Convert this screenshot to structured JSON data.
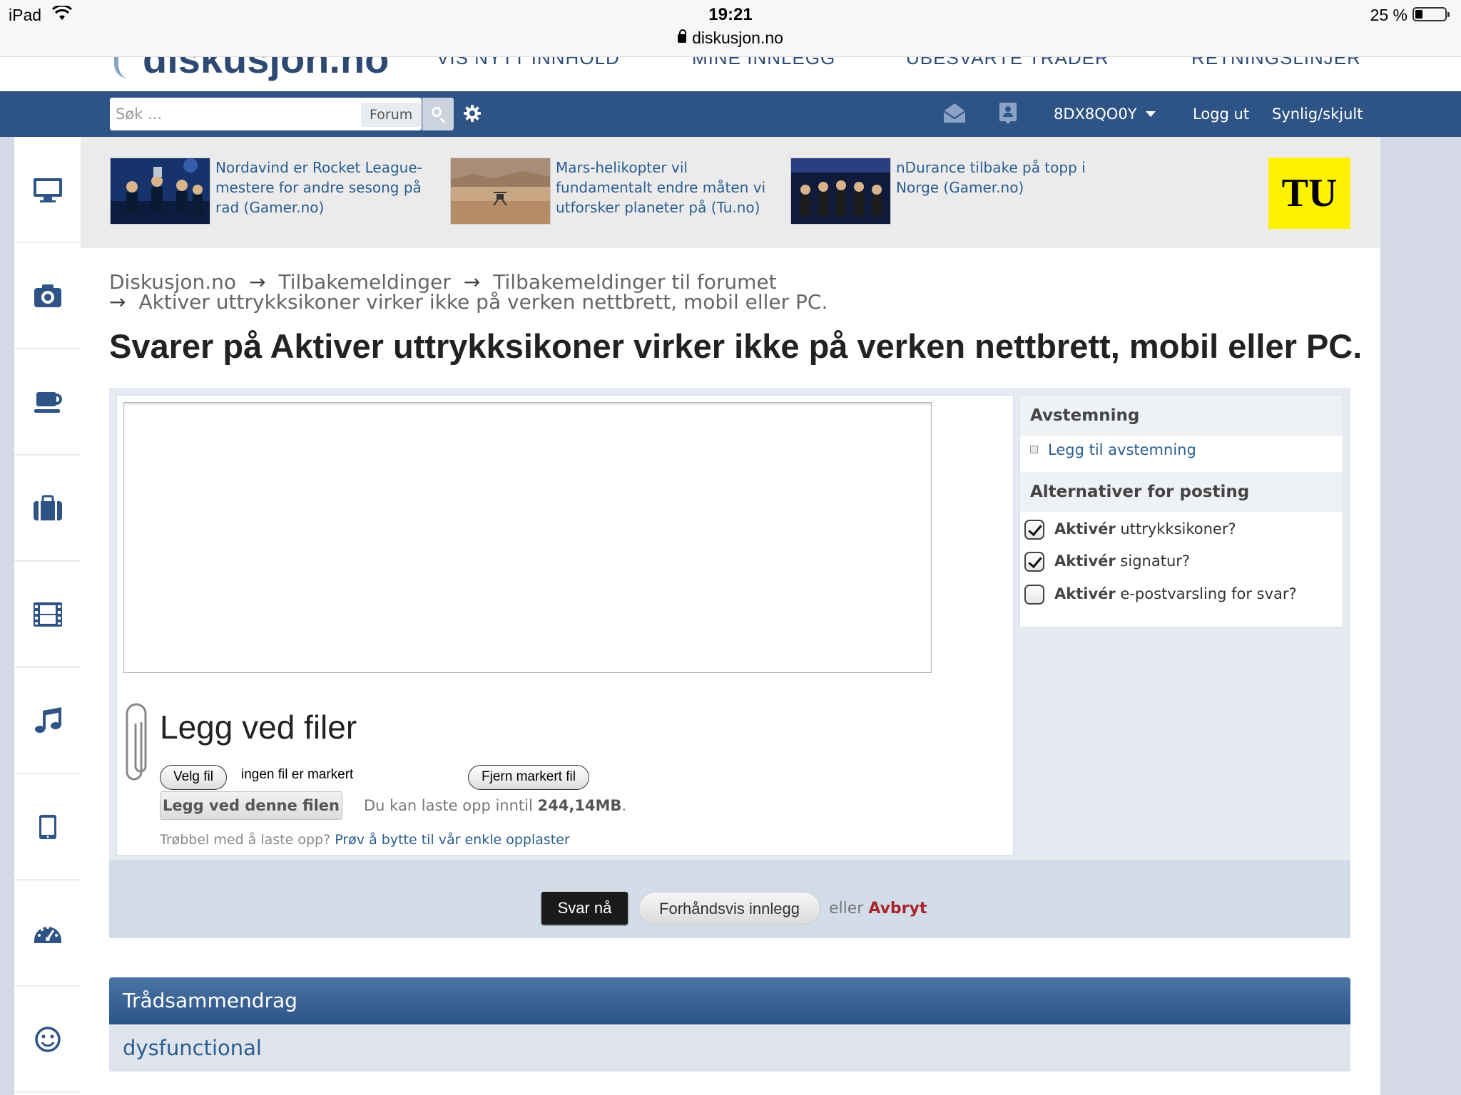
{
  "status_bar": {
    "device": "iPad",
    "time": "19:21",
    "url": "diskusjon.no",
    "battery": "25 %"
  },
  "header": {
    "nav_cut": [
      "VIS NYTT INNHOLD",
      "MINE INNLEGG",
      "UBESVARTE TRÅDER",
      "RETNINGSLINJER"
    ]
  },
  "navbar": {
    "search_placeholder": "Søk ...",
    "search_scope": "Forum",
    "username": "8DX8QO0Y",
    "logout": "Logg ut",
    "visibility": "Synlig/skjult"
  },
  "sidebar": {
    "icons": [
      "monitor-icon",
      "camera-icon",
      "coffee-icon",
      "briefcase-icon",
      "film-icon",
      "music-icon",
      "tablet-icon",
      "speedometer-icon",
      "smiley-icon"
    ]
  },
  "news": [
    {
      "text": "Nordavind er Rocket League-mestere for andre sesong på rad (Gamer.no)"
    },
    {
      "text": "Mars-helikopter vil fundamentalt endre måten vi utforsker planeter på (Tu.no)"
    },
    {
      "text": "nDurance tilbake på topp i Norge (Gamer.no)"
    }
  ],
  "ad_logo": "TU",
  "breadcrumb": {
    "items": [
      "Diskusjon.no",
      "Tilbakemeldinger",
      "Tilbakemeldinger til forumet"
    ],
    "current": "Aktiver uttrykksikoner virker ikke på verken nettbrett, mobil eller PC."
  },
  "page_title": "Svarer på Aktiver uttrykksikoner virker ikke på verken nettbrett, mobil eller PC.",
  "attach": {
    "title": "Legg ved filer",
    "choose": "Velg fil",
    "no_file": "ingen fil er markert",
    "remove": "Fjern markert fil",
    "attach_button": "Legg ved denne filen",
    "limit_prefix": "Du kan laste opp inntil ",
    "limit_value": "244,14MB",
    "limit_suffix": ".",
    "trouble_prefix": "Trøbbel med å laste opp? ",
    "trouble_link": "Prøv å bytte til vår enkle opplaster"
  },
  "options": {
    "poll_head": "Avstemning",
    "add_poll": "Legg til avstemning",
    "posting_head": "Alternativer for posting",
    "checks": [
      {
        "bold": "Aktivér",
        "rest": " uttrykksikoner?",
        "checked": true
      },
      {
        "bold": "Aktivér",
        "rest": " signatur?",
        "checked": true
      },
      {
        "bold": "Aktivér",
        "rest": " e-postvarsling for svar?",
        "checked": false
      }
    ]
  },
  "submit": {
    "reply": "Svar nå",
    "preview": "Forhåndsvis innlegg",
    "or": "eller ",
    "cancel": "Avbryt"
  },
  "summary": {
    "head": "Trådsammendrag",
    "user": "dysfunctional"
  },
  "colors": {
    "navbar": "#2e5486",
    "link": "#2a5d91",
    "cancel": "#a8262b",
    "ad_yellow": "#fff200"
  }
}
